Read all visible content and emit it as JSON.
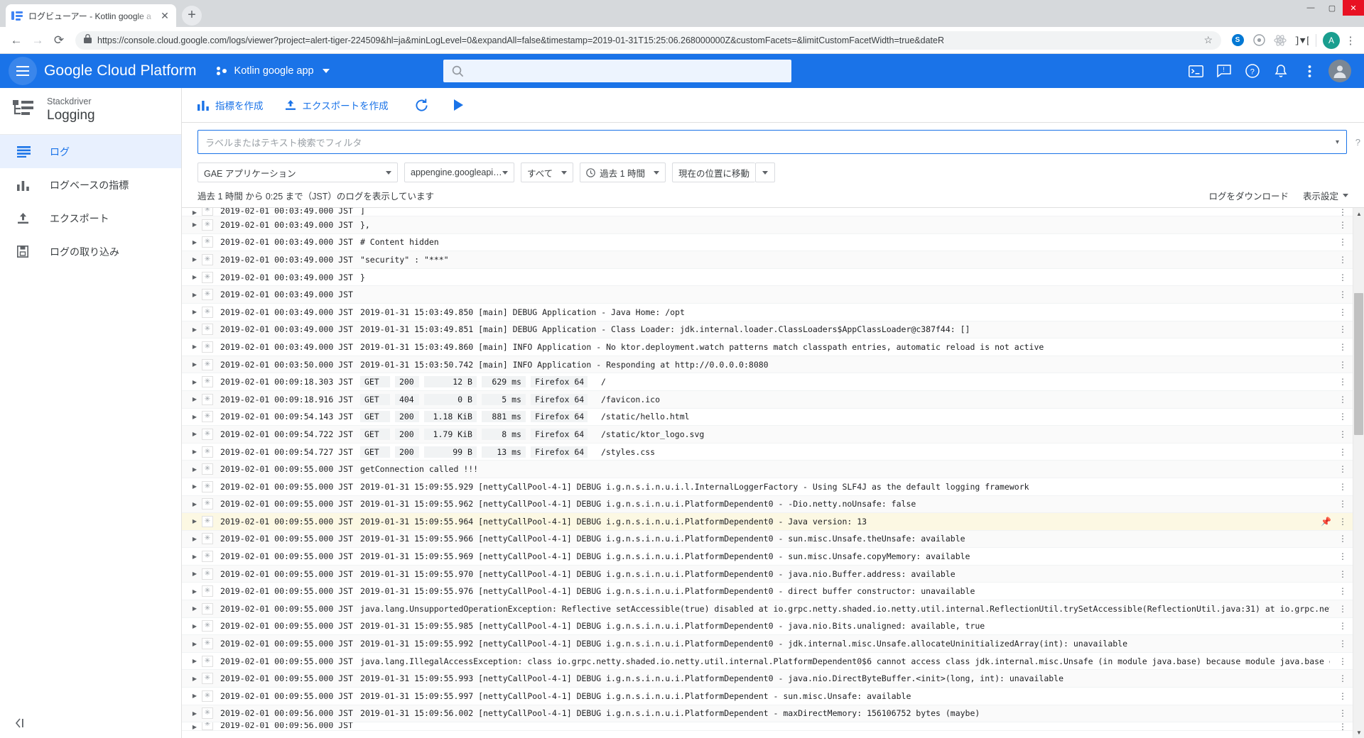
{
  "browser": {
    "tab_title": "ログビューアー - Kotlin google a",
    "tab_close_label": "✕",
    "new_tab_label": "+",
    "window_minimize": "—",
    "window_maximize": "▢",
    "window_close": "✕",
    "url": "https://console.cloud.google.com/logs/viewer?project=alert-tiger-224509&hl=ja&minLogLevel=0&expandAll=false&timestamp=2019-01-31T15:25:06.268000000Z&customFacets=&limitCustomFacetWidth=true&dateR",
    "back_label": "←",
    "forward_label": "→",
    "reload_label": "⟳",
    "star_label": "☆",
    "menu_label": "⋮",
    "extension_badge": "S",
    "profile_initial": "A"
  },
  "header": {
    "product_title": "Google Cloud Platform",
    "project_name": "Kotlin google app",
    "search_placeholder": "",
    "accent_color": "#1a73e8"
  },
  "sidebar": {
    "brand_sub": "Stackdriver",
    "brand_name": "Logging",
    "collapse_label": "◁|",
    "items": [
      {
        "label": "ログ",
        "icon": "list-icon",
        "active": true
      },
      {
        "label": "ログベースの指標",
        "icon": "bar-chart-icon",
        "active": false
      },
      {
        "label": "エクスポート",
        "icon": "upload-icon",
        "active": false
      },
      {
        "label": "ログの取り込み",
        "icon": "save-icon",
        "active": false
      }
    ]
  },
  "toolbar": {
    "create_metric_label": "指標を作成",
    "create_export_label": "エクスポートを作成",
    "refresh_label": "↻",
    "play_label": "▶"
  },
  "filter": {
    "placeholder": "ラベルまたはテキスト検索でフィルタ",
    "value": "",
    "help_label": "?",
    "caret_label": "▾"
  },
  "selectors": {
    "resource": "GAE アプリケーション",
    "log_name": "appengine.googleapis....",
    "severity": "すべて",
    "time_range": "過去 1 時間",
    "jump_to": "現在の位置に移動"
  },
  "status": {
    "message": "過去 1 時間 から 0:25 まで（JST）のログを表示しています",
    "download_label": "ログをダウンロード",
    "view_options_label": "表示設定"
  },
  "logs": {
    "arrow_glyph": "▶",
    "severity_glyph": "✳",
    "kebab_glyph": "⋮",
    "pin_glyph": "📌",
    "rows": [
      {
        "clipped": true,
        "ts": "2019-02-01 00:03:49.000 JST",
        "msg": "]"
      },
      {
        "ts": "2019-02-01 00:03:49.000 JST",
        "msg": "},"
      },
      {
        "ts": "2019-02-01 00:03:49.000 JST",
        "msg": "# Content hidden"
      },
      {
        "ts": "2019-02-01 00:03:49.000 JST",
        "msg": "\"security\" : \"***\""
      },
      {
        "ts": "2019-02-01 00:03:49.000 JST",
        "msg": "}"
      },
      {
        "ts": "2019-02-01 00:03:49.000 JST",
        "msg": ""
      },
      {
        "ts": "2019-02-01 00:03:49.000 JST",
        "msg": "2019-01-31 15:03:49.850 [main] DEBUG Application - Java Home: /opt"
      },
      {
        "ts": "2019-02-01 00:03:49.000 JST",
        "msg": "2019-01-31 15:03:49.851 [main] DEBUG Application - Class Loader: jdk.internal.loader.ClassLoaders$AppClassLoader@c387f44: []"
      },
      {
        "ts": "2019-02-01 00:03:49.000 JST",
        "msg": "2019-01-31 15:03:49.860 [main] INFO  Application - No ktor.deployment.watch patterns match classpath entries, automatic reload is not active"
      },
      {
        "ts": "2019-02-01 00:03:50.000 JST",
        "msg": "2019-01-31 15:03:50.742 [main] INFO  Application - Responding at http://0.0.0.0:8080"
      },
      {
        "ts": "2019-02-01 00:09:18.303 JST",
        "http": {
          "method": "GET",
          "status": "200",
          "size": "12 B",
          "latency": "629 ms",
          "agent": "Firefox 64",
          "path": "/"
        }
      },
      {
        "ts": "2019-02-01 00:09:18.916 JST",
        "http": {
          "method": "GET",
          "status": "404",
          "size": "0 B",
          "latency": "5 ms",
          "agent": "Firefox 64",
          "path": "/favicon.ico"
        }
      },
      {
        "ts": "2019-02-01 00:09:54.143 JST",
        "http": {
          "method": "GET",
          "status": "200",
          "size": "1.18 KiB",
          "latency": "881 ms",
          "agent": "Firefox 64",
          "path": "/static/hello.html"
        }
      },
      {
        "ts": "2019-02-01 00:09:54.722 JST",
        "http": {
          "method": "GET",
          "status": "200",
          "size": "1.79 KiB",
          "latency": "8 ms",
          "agent": "Firefox 64",
          "path": "/static/ktor_logo.svg"
        }
      },
      {
        "ts": "2019-02-01 00:09:54.727 JST",
        "http": {
          "method": "GET",
          "status": "200",
          "size": "99 B",
          "latency": "13 ms",
          "agent": "Firefox 64",
          "path": "/styles.css"
        }
      },
      {
        "ts": "2019-02-01 00:09:55.000 JST",
        "msg": "getConnection called !!!"
      },
      {
        "ts": "2019-02-01 00:09:55.000 JST",
        "msg": "2019-01-31 15:09:55.929 [nettyCallPool-4-1] DEBUG i.g.n.s.i.n.u.i.l.InternalLoggerFactory - Using SLF4J as the default logging framework"
      },
      {
        "ts": "2019-02-01 00:09:55.000 JST",
        "msg": "2019-01-31 15:09:55.962 [nettyCallPool-4-1] DEBUG i.g.n.s.i.n.u.i.PlatformDependent0 - -Dio.netty.noUnsafe: false"
      },
      {
        "ts": "2019-02-01 00:09:55.000 JST",
        "msg": "2019-01-31 15:09:55.964 [nettyCallPool-4-1] DEBUG i.g.n.s.i.n.u.i.PlatformDependent0 - Java version: 13",
        "highlight": true,
        "pinned": true
      },
      {
        "ts": "2019-02-01 00:09:55.000 JST",
        "msg": "2019-01-31 15:09:55.966 [nettyCallPool-4-1] DEBUG i.g.n.s.i.n.u.i.PlatformDependent0 - sun.misc.Unsafe.theUnsafe: available"
      },
      {
        "ts": "2019-02-01 00:09:55.000 JST",
        "msg": "2019-01-31 15:09:55.969 [nettyCallPool-4-1] DEBUG i.g.n.s.i.n.u.i.PlatformDependent0 - sun.misc.Unsafe.copyMemory: available"
      },
      {
        "ts": "2019-02-01 00:09:55.000 JST",
        "msg": "2019-01-31 15:09:55.970 [nettyCallPool-4-1] DEBUG i.g.n.s.i.n.u.i.PlatformDependent0 - java.nio.Buffer.address: available"
      },
      {
        "ts": "2019-02-01 00:09:55.000 JST",
        "msg": "2019-01-31 15:09:55.976 [nettyCallPool-4-1] DEBUG i.g.n.s.i.n.u.i.PlatformDependent0 - direct buffer constructor: unavailable"
      },
      {
        "ts": "2019-02-01 00:09:55.000 JST",
        "msg": "java.lang.UnsupportedOperationException: Reflective setAccessible(true) disabled at io.grpc.netty.shaded.io.netty.util.internal.ReflectionUtil.trySetAccessible(ReflectionUtil.java:31) at io.grpc.netty.shaded.io.netty.uti"
      },
      {
        "ts": "2019-02-01 00:09:55.000 JST",
        "msg": "2019-01-31 15:09:55.985 [nettyCallPool-4-1] DEBUG i.g.n.s.i.n.u.i.PlatformDependent0 - java.nio.Bits.unaligned: available, true"
      },
      {
        "ts": "2019-02-01 00:09:55.000 JST",
        "msg": "2019-01-31 15:09:55.992 [nettyCallPool-4-1] DEBUG i.g.n.s.i.n.u.i.PlatformDependent0 - jdk.internal.misc.Unsafe.allocateUninitializedArray(int): unavailable"
      },
      {
        "ts": "2019-02-01 00:09:55.000 JST",
        "msg": "java.lang.IllegalAccessException: class io.grpc.netty.shaded.io.netty.util.internal.PlatformDependent0$6 cannot access class jdk.internal.misc.Unsafe (in module java.base) because module java.base does not export jdk.int"
      },
      {
        "ts": "2019-02-01 00:09:55.000 JST",
        "msg": "2019-01-31 15:09:55.993 [nettyCallPool-4-1] DEBUG i.g.n.s.i.n.u.i.PlatformDependent0 - java.nio.DirectByteBuffer.<init>(long, int): unavailable"
      },
      {
        "ts": "2019-02-01 00:09:55.000 JST",
        "msg": "2019-01-31 15:09:55.997 [nettyCallPool-4-1] DEBUG i.g.n.s.i.n.u.i.PlatformDependent - sun.misc.Unsafe: available"
      },
      {
        "ts": "2019-02-01 00:09:56.000 JST",
        "msg": "2019-01-31 15:09:56.002 [nettyCallPool-4-1] DEBUG i.g.n.s.i.n.u.i.PlatformDependent - maxDirectMemory: 156106752 bytes (maybe)"
      },
      {
        "clipped": true,
        "ts": "2019-02-01 00:09:56.000 JST",
        "msg": ""
      }
    ]
  }
}
